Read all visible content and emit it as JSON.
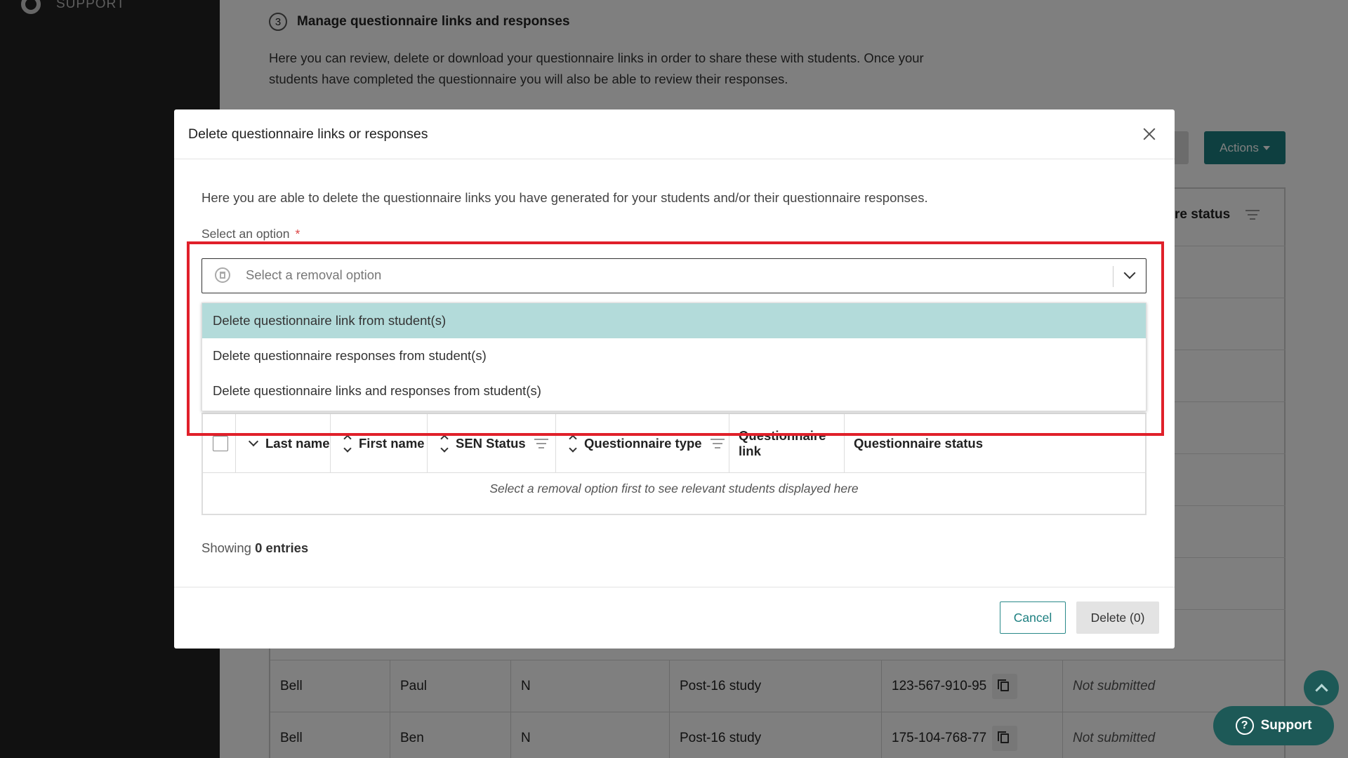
{
  "sidebar": {
    "support_label": "SUPPORT"
  },
  "background": {
    "step_number": "3",
    "step_title": "Manage questionnaire links and responses",
    "step_description": "Here you can review, delete or download your questionnaire links in order to share these with students. Once your students have completed the questionnaire you will also be able to review their responses.",
    "actions_label": "Actions",
    "status_header_fragment": "re status",
    "rows": [
      {
        "last": "Bell",
        "first": "Paul",
        "sen": "N",
        "type": "Post-16 study",
        "link": "123-567-910-95",
        "status": "Not submitted"
      },
      {
        "last": "Bell",
        "first": "Ben",
        "sen": "N",
        "type": "Post-16 study",
        "link": "175-104-768-77",
        "status": "Not submitted"
      }
    ]
  },
  "modal": {
    "title": "Delete questionnaire links or responses",
    "intro": "Here you are able to delete the questionnaire links you have generated for your students and/or their questionnaire responses.",
    "field_label": "Select an option",
    "required_mark": "*",
    "select_placeholder": "Select a removal option",
    "options": [
      "Delete questionnaire link from student(s)",
      "Delete questionnaire responses from student(s)",
      "Delete questionnaire links and responses from student(s)"
    ],
    "table_headers": {
      "last_name": "Last name",
      "first_name": "First name",
      "sen_status": "SEN Status",
      "questionnaire_type": "Questionnaire type",
      "questionnaire_link": "Questionnaire link",
      "questionnaire_status": "Questionnaire status"
    },
    "empty_message": "Select a removal option first to see relevant students displayed here",
    "showing_prefix": "Showing",
    "showing_count": "0 entries",
    "cancel_label": "Cancel",
    "delete_label": "Delete (0)"
  },
  "widgets": {
    "support_label": "Support",
    "help_glyph": "?"
  },
  "colors": {
    "accent": "#1c7f80",
    "highlight": "#e0202a",
    "option_active": "#b3dbda"
  }
}
